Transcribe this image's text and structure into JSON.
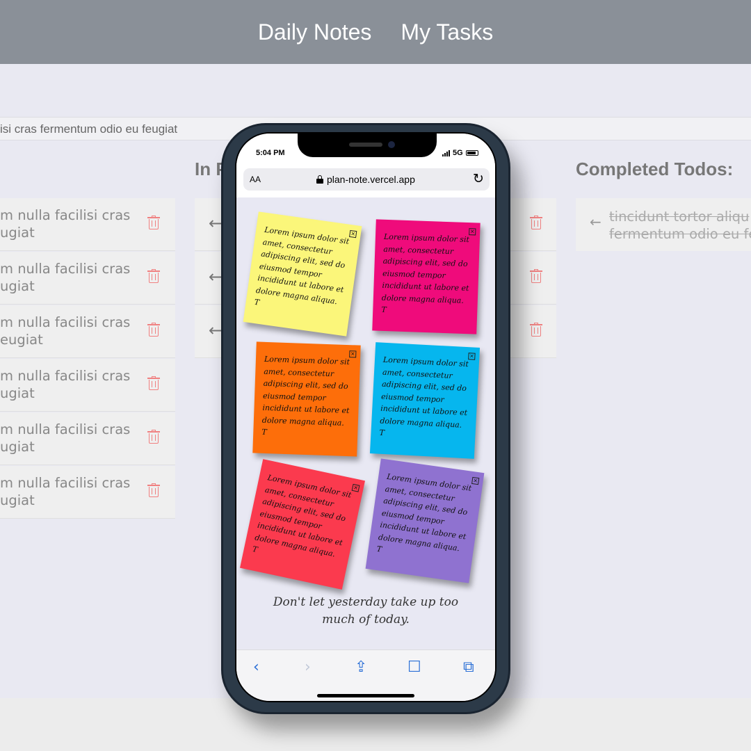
{
  "desktop": {
    "nav": [
      "Daily Notes",
      "My Tasks"
    ],
    "input_value": "isi cras fermentum odio eu feugiat",
    "columns": {
      "in_progress_title": "In P",
      "completed_title": "Completed Todos:"
    },
    "todo_items": [
      {
        "line1": "m nulla facilisi cras",
        "line2": "ugiat"
      },
      {
        "line1": "m nulla facilisi cras",
        "line2": "ugiat"
      },
      {
        "line1": "m nulla facilisi cras",
        "line2": "eugiat"
      },
      {
        "line1": "m nulla facilisi cras",
        "line2": "ugiat"
      },
      {
        "line1": "m nulla facilisi cras",
        "line2": "ugiat"
      },
      {
        "line1": "m nulla facilisi cras",
        "line2": "ugiat"
      }
    ],
    "completed_items": [
      {
        "line1": "tincidunt tortor aliqu",
        "line2": "fermentum odio eu fe"
      }
    ],
    "icons": {
      "trash": "trash-icon",
      "arrow": "arrow-left-icon"
    }
  },
  "phone": {
    "status": {
      "time": "5:04 PM",
      "network": "5G"
    },
    "browser": {
      "text_size": "AA",
      "url": "plan-note.vercel.app"
    },
    "notes": [
      {
        "text": "Lorem ipsum dolor sit amet, consectetur adipiscing elit, sed do eiusmod tempor incididunt ut labore et dolore magna aliqua. T",
        "color": "#fbf67a"
      },
      {
        "text": "Lorem ipsum dolor sit amet, consectetur adipiscing elit, sed do eiusmod tempor incididunt ut labore et dolore magna aliqua. T",
        "color": "#ef0b7b"
      },
      {
        "text": "Lorem ipsum dolor sit amet, consectetur adipiscing elit, sed do eiusmod tempor incididunt ut labore et dolore magna aliqua. T",
        "color": "#fd6e0a"
      },
      {
        "text": "Lorem ipsum dolor sit amet, consectetur adipiscing elit, sed do eiusmod tempor incididunt ut labore et dolore magna aliqua. T",
        "color": "#06b6ee"
      },
      {
        "text": "Lorem ipsum dolor sit amet, consectetur adipiscing elit, sed do eiusmod tempor incididunt ut labore et dolore magna aliqua. T",
        "color": "#fb3a4e"
      },
      {
        "text": "Lorem ipsum dolor sit amet, consectetur adipiscing elit, sed do eiusmod tempor incididunt ut labore et dolore magna aliqua. T",
        "color": "#8f72d0"
      }
    ],
    "note_close_glyph": "×",
    "quote": "Don't let yesterday take up too much of today.",
    "toolbar_icons": [
      "back-icon",
      "forward-icon",
      "share-icon",
      "bookmarks-icon",
      "tabs-icon"
    ]
  }
}
